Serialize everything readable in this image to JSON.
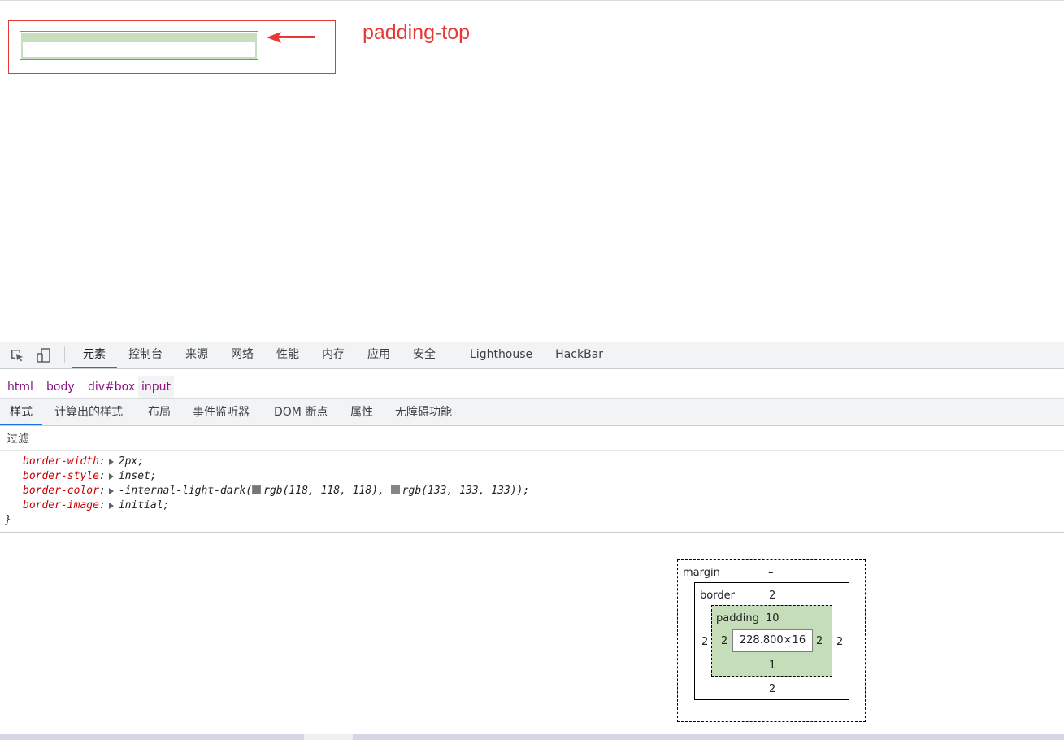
{
  "preview": {
    "annotation_label": "padding-top"
  },
  "devtools": {
    "tabs": [
      "元素",
      "控制台",
      "来源",
      "网络",
      "性能",
      "内存",
      "应用",
      "安全",
      "Lighthouse",
      "HackBar"
    ],
    "active_tab": "元素",
    "breadcrumb": [
      "html",
      "body",
      "div#box",
      "input"
    ],
    "selected_crumb": "input",
    "sidebar_tabs": [
      "样式",
      "计算出的样式",
      "布局",
      "事件监听器",
      "DOM 断点",
      "属性",
      "无障碍功能"
    ],
    "active_sidebar_tab": "样式",
    "filter_placeholder": "过滤",
    "declarations": [
      {
        "prop": "border-width",
        "value": "2px;"
      },
      {
        "prop": "border-style",
        "value": "inset;"
      },
      {
        "prop": "border-color",
        "value_prefix": "-internal-light-dark(",
        "color1": "rgb(118, 118, 118),",
        "color2": "rgb(133, 133, 133));"
      },
      {
        "prop": "border-image",
        "value": "initial;"
      }
    ],
    "closing_brace": "}",
    "box_model": {
      "margin_label": "margin",
      "margin_top": "–",
      "margin_bottom": "–",
      "margin_left": "–",
      "margin_right": "–",
      "border_label": "border",
      "border_top": "2",
      "border_bottom": "2",
      "border_left": "2",
      "border_right": "2",
      "padding_label": "padding",
      "padding_top": "10",
      "padding_bottom": "1",
      "padding_left": "2",
      "padding_right": "2",
      "content_size": "228.800×16"
    }
  },
  "colors": {
    "annotation": "#e53935",
    "padding_fill": "#c5deb9",
    "css_property": "#c80000",
    "breadcrumb": "#881280",
    "active_tab_underline": "#1a73e8"
  },
  "icons": [
    "inspect-element-icon",
    "device-toolbar-icon",
    "arrow-icon"
  ]
}
